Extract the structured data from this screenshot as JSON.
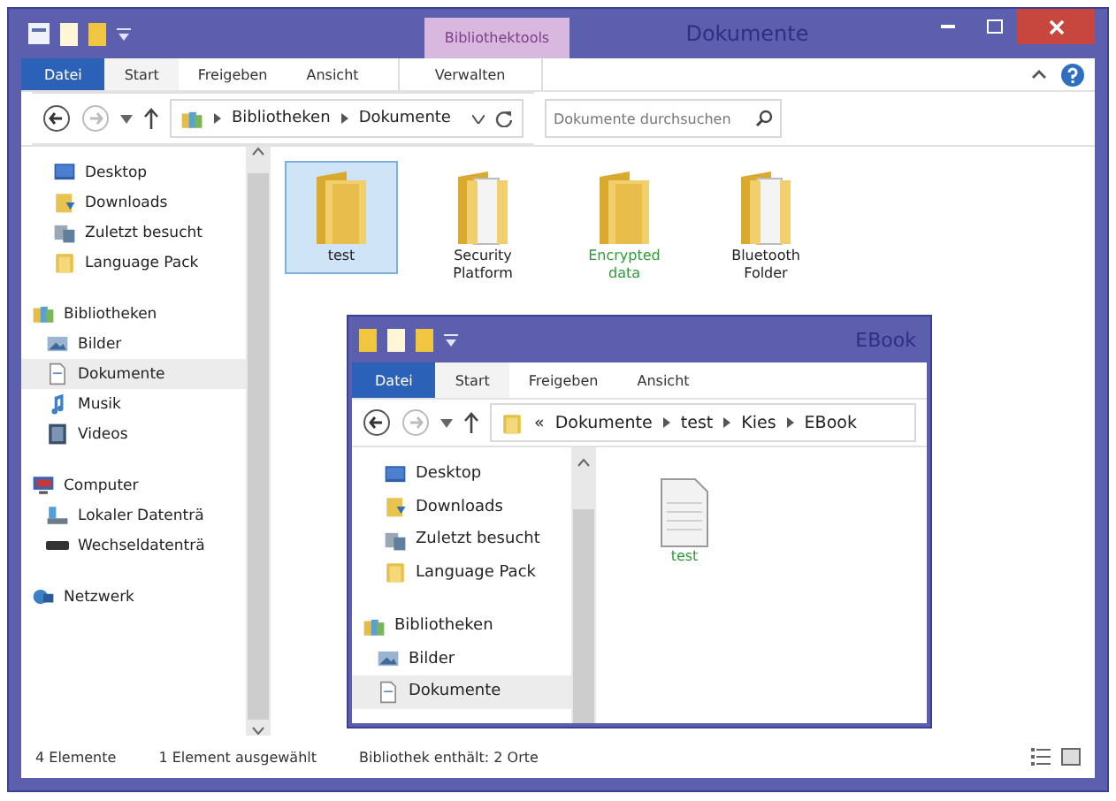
{
  "window": {
    "title": "Dokumente",
    "contextual_tab": "Bibliothektools",
    "ribbon_tabs": [
      {
        "label": "Datei",
        "kind": "file",
        "selected": false
      },
      {
        "label": "Start",
        "kind": "tab",
        "selected": true
      },
      {
        "label": "Freigeben",
        "kind": "tab",
        "selected": false
      },
      {
        "label": "Ansicht",
        "kind": "tab",
        "selected": false
      },
      {
        "label": "Verwalten",
        "kind": "contextual",
        "selected": false
      }
    ],
    "address": {
      "path": [
        "Bibliotheken",
        "Dokumente"
      ]
    },
    "search": {
      "placeholder": "Dokumente durchsuchen"
    },
    "nav": [
      {
        "items": [
          {
            "label": "Desktop",
            "kind": "desktop",
            "selected": false
          },
          {
            "label": "Downloads",
            "kind": "downloads",
            "selected": false
          },
          {
            "label": "Zuletzt besucht",
            "kind": "recent",
            "selected": false
          },
          {
            "label": "Language Pack",
            "kind": "folder",
            "selected": false
          }
        ]
      },
      {
        "label": "Bibliotheken",
        "kind": "library",
        "children": [
          {
            "label": "Bilder",
            "kind": "pictures",
            "selected": false
          },
          {
            "label": "Dokumente",
            "kind": "documents",
            "selected": true
          },
          {
            "label": "Musik",
            "kind": "music",
            "selected": false
          },
          {
            "label": "Videos",
            "kind": "videos",
            "selected": false
          }
        ]
      },
      {
        "label": "Computer",
        "kind": "computer",
        "children": [
          {
            "label": "Lokaler Datenträ",
            "kind": "drive",
            "selected": false
          },
          {
            "label": "Wechseldatenträ",
            "kind": "removable",
            "selected": false
          }
        ]
      },
      {
        "label": "Netzwerk",
        "kind": "network"
      }
    ],
    "files": [
      {
        "label": "test",
        "kind": "folder",
        "selected": true,
        "encrypted": false
      },
      {
        "label": "Security Platform",
        "kind": "folder-papers",
        "selected": false,
        "encrypted": false
      },
      {
        "label": "Encrypted data",
        "kind": "folder",
        "selected": false,
        "encrypted": true
      },
      {
        "label": "Bluetooth Folder",
        "kind": "folder-papers",
        "selected": false,
        "encrypted": false
      }
    ],
    "status_bar": [
      "4 Elemente",
      "1 Element ausgewählt",
      "Bibliothek enthält: 2 Orte"
    ]
  },
  "inner_window": {
    "title": "EBook",
    "ribbon_tabs": [
      {
        "label": "Datei",
        "kind": "file",
        "selected": false
      },
      {
        "label": "Start",
        "kind": "tab",
        "selected": true
      },
      {
        "label": "Freigeben",
        "kind": "tab",
        "selected": false
      },
      {
        "label": "Ansicht",
        "kind": "tab",
        "selected": false
      }
    ],
    "address": {
      "overflow": "«",
      "path": [
        "Dokumente",
        "test",
        "Kies",
        "EBook"
      ]
    },
    "nav": [
      {
        "items": [
          {
            "label": "Desktop",
            "kind": "desktop",
            "selected": false
          },
          {
            "label": "Downloads",
            "kind": "downloads",
            "selected": false
          },
          {
            "label": "Zuletzt besucht",
            "kind": "recent",
            "selected": false
          },
          {
            "label": "Language Pack",
            "kind": "folder",
            "selected": false
          }
        ]
      },
      {
        "label": "Bibliotheken",
        "kind": "library",
        "children": [
          {
            "label": "Bilder",
            "kind": "pictures",
            "selected": false
          },
          {
            "label": "Dokumente",
            "kind": "documents",
            "selected": true
          }
        ]
      }
    ],
    "files": [
      {
        "label": "test",
        "kind": "document",
        "selected": false,
        "encrypted": true
      }
    ]
  }
}
